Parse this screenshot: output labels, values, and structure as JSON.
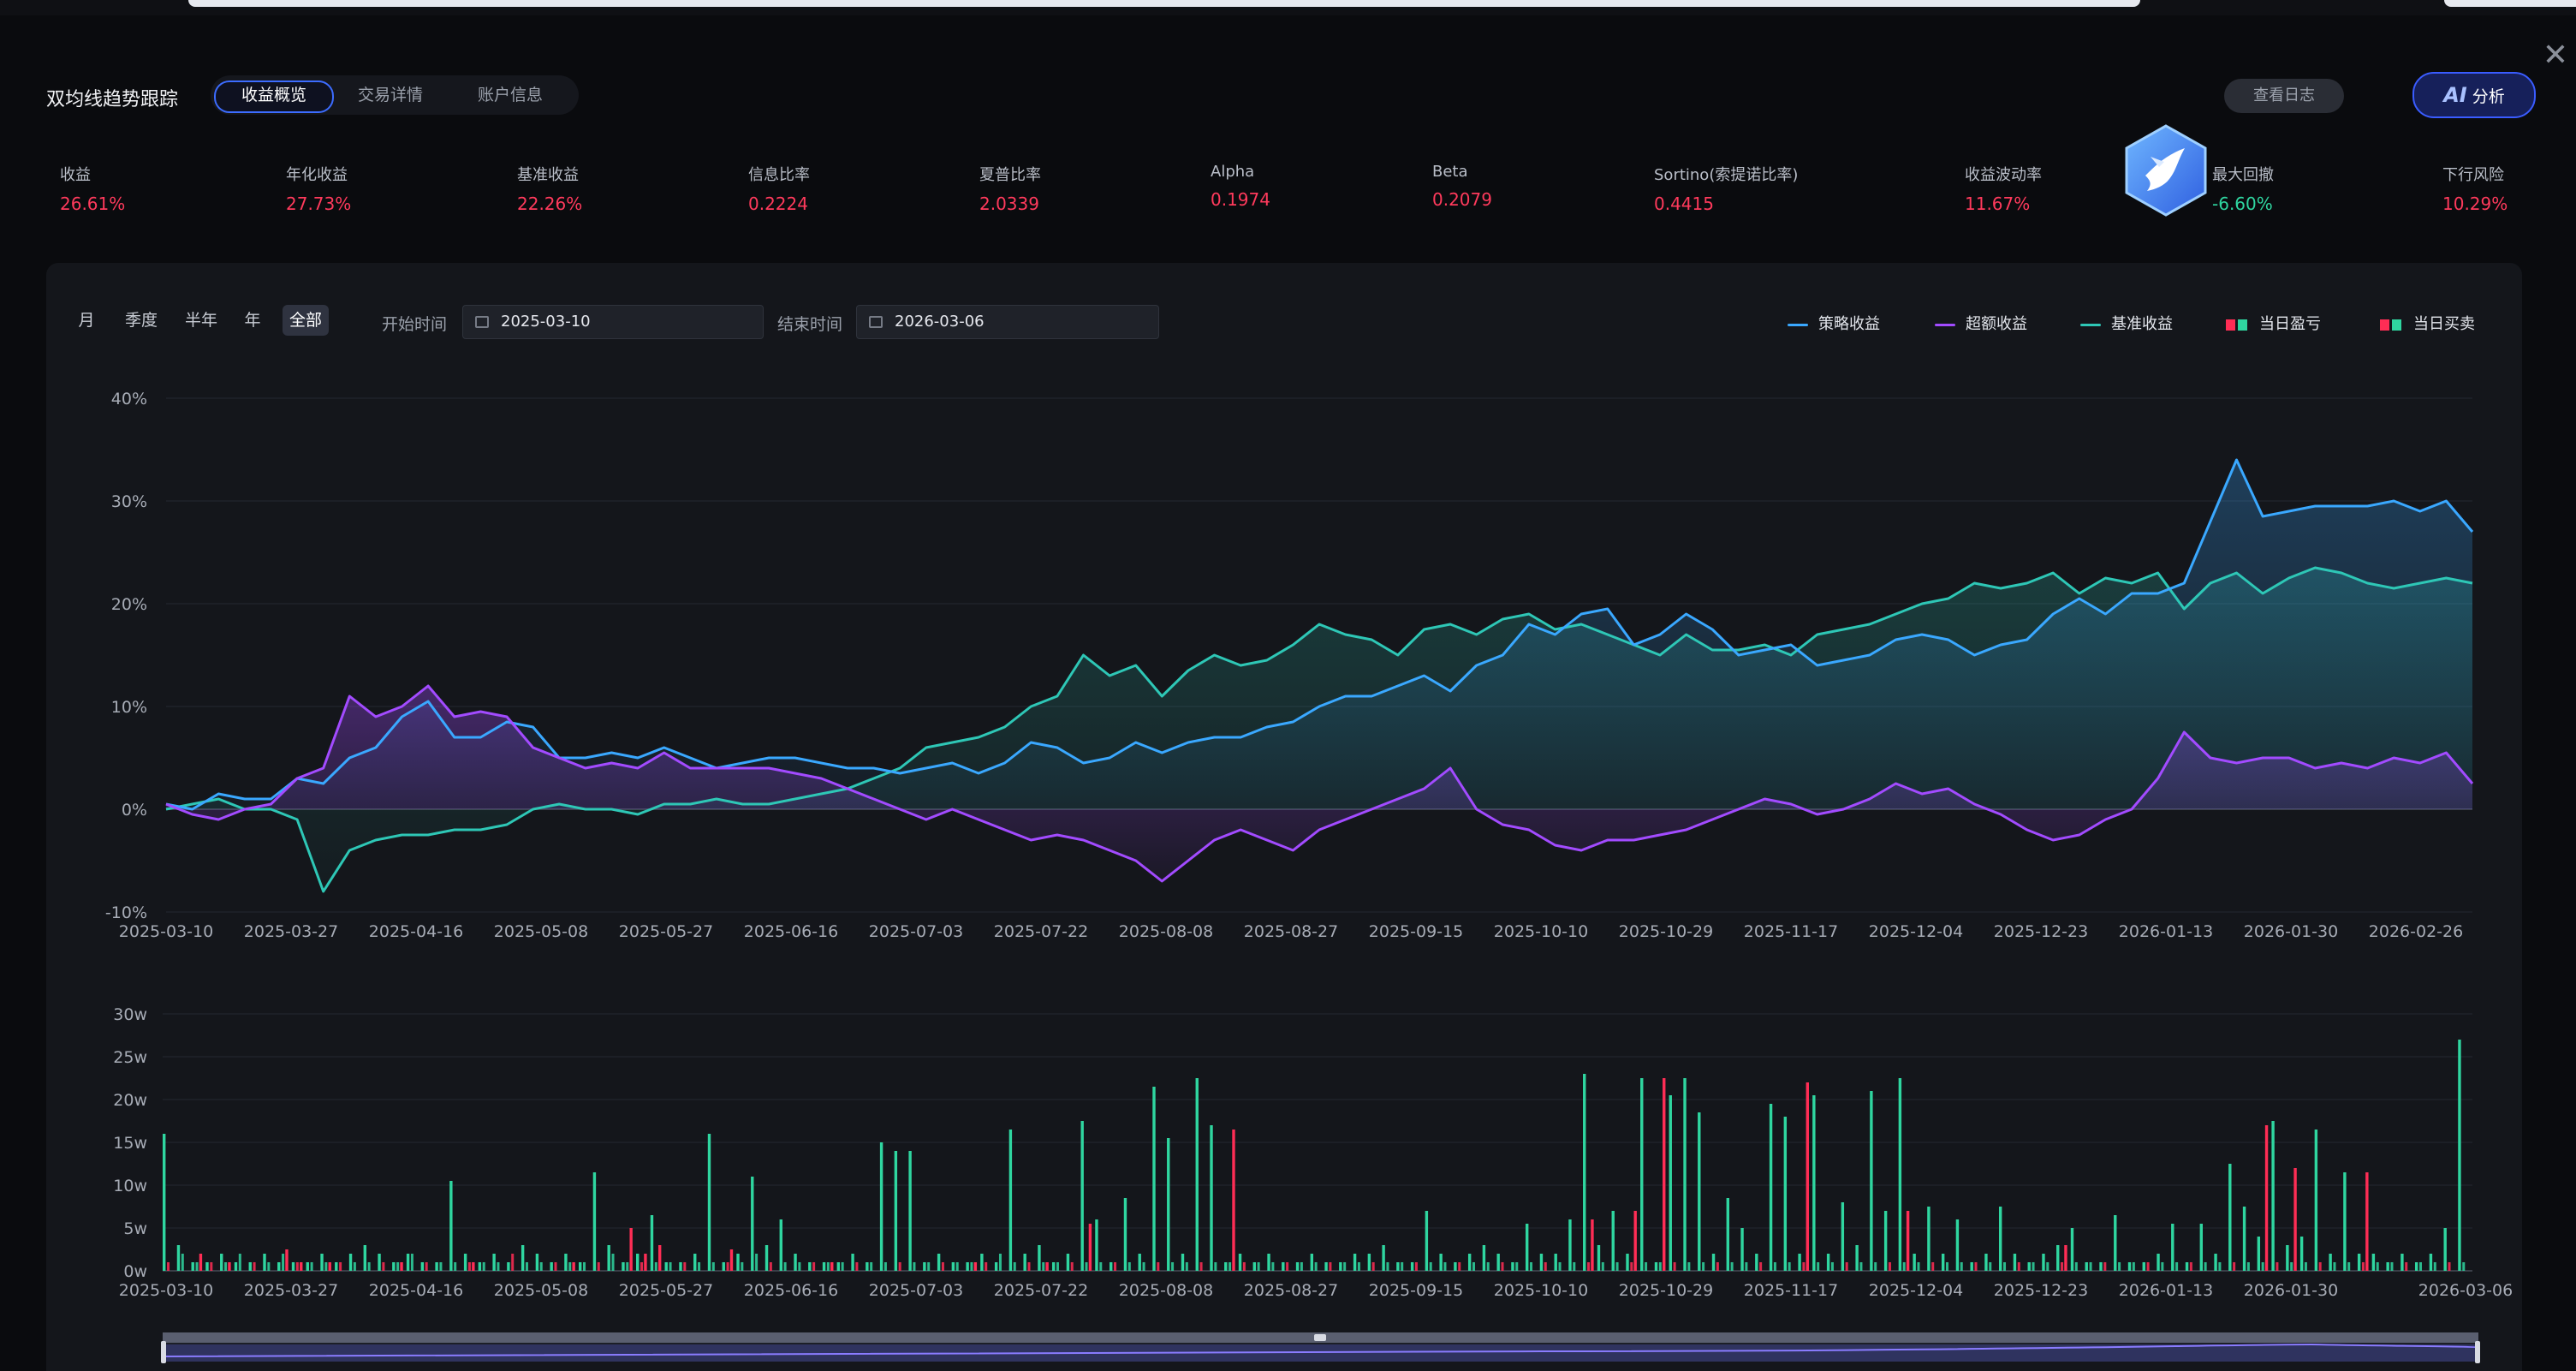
{
  "page": {
    "title": "双均线趋势跟踪",
    "tabs": [
      {
        "label": "收益概览",
        "active": true
      },
      {
        "label": "交易详情",
        "active": false
      },
      {
        "label": "账户信息",
        "active": false
      }
    ],
    "log_button": "查看日志",
    "ai_button": {
      "badge": "AI",
      "label": "分析"
    },
    "close": "✕"
  },
  "stats": [
    {
      "label": "收益",
      "value": "26.61%",
      "color": "#ff3a5c"
    },
    {
      "label": "年化收益",
      "value": "27.73%",
      "color": "#ff3a5c"
    },
    {
      "label": "基准收益",
      "value": "22.26%",
      "color": "#ff3a5c"
    },
    {
      "label": "信息比率",
      "value": "0.2224",
      "color": "#ff3a5c"
    },
    {
      "label": "夏普比率",
      "value": "2.0339",
      "color": "#ff3a5c"
    },
    {
      "label": "Alpha",
      "value": "0.1974",
      "color": "#ff3a5c"
    },
    {
      "label": "Beta",
      "value": "0.2079",
      "color": "#ff3a5c"
    },
    {
      "label": "Sortino(索提诺比率)",
      "value": "0.4415",
      "color": "#ff3a5c"
    },
    {
      "label": "收益波动率",
      "value": "11.67%",
      "color": "#ff3a5c"
    },
    {
      "label": "最大回撤",
      "value": "-6.60%",
      "color": "#2fd6a0"
    },
    {
      "label": "下行风险",
      "value": "10.29%",
      "color": "#ff3a5c"
    }
  ],
  "controls": {
    "periods": [
      {
        "label": "月",
        "active": false
      },
      {
        "label": "季度",
        "active": false
      },
      {
        "label": "半年",
        "active": false
      },
      {
        "label": "年",
        "active": false
      },
      {
        "label": "全部",
        "active": true
      }
    ],
    "start_label": "开始时间",
    "start_value": "2025-03-10",
    "end_label": "结束时间",
    "end_value": "2026-03-06"
  },
  "legend": [
    {
      "label": "策略收益",
      "color": "#3aa8ff",
      "kind": "line"
    },
    {
      "label": "超额收益",
      "color": "#a24bff",
      "kind": "line"
    },
    {
      "label": "基准收益",
      "color": "#2ec7b6",
      "kind": "line"
    },
    {
      "label": "当日盈亏",
      "colors": [
        "#ff2d55",
        "#2fd6a0"
      ],
      "kind": "squares"
    },
    {
      "label": "当日买卖",
      "colors": [
        "#ff2d55",
        "#2fd6a0"
      ],
      "kind": "squares"
    }
  ],
  "colors": {
    "strategy": "#3aa8ff",
    "excess": "#a24bff",
    "benchmark": "#2ec7b6",
    "up": "#ff2d55",
    "down": "#2fd6a0",
    "grid": "#252831",
    "axis_text": "#a7acb6"
  },
  "chart_data": [
    {
      "type": "line",
      "title": "",
      "xlabel": "",
      "ylabel": "",
      "ylim": [
        -10,
        40
      ],
      "yticks": [
        "40%",
        "30%",
        "20%",
        "10%",
        "0%",
        "-10%"
      ],
      "yticks_values": [
        40,
        30,
        20,
        10,
        0,
        -10
      ],
      "xtick_labels": [
        "2025-03-10",
        "2025-03-27",
        "2025-04-16",
        "2025-05-08",
        "2025-05-27",
        "2025-06-16",
        "2025-07-03",
        "2025-07-22",
        "2025-08-08",
        "2025-08-27",
        "2025-09-15",
        "2025-10-10",
        "2025-10-29",
        "2025-11-17",
        "2025-12-04",
        "2025-12-23",
        "2026-01-13",
        "2026-01-30",
        "2026-02-26"
      ],
      "grid": true,
      "legend_placement": "top-right",
      "series": [
        {
          "name": "策略收益",
          "key": "strategy",
          "values": [
            0.5,
            0,
            1.5,
            1,
            1,
            3,
            2.5,
            5,
            6,
            9,
            10.5,
            7,
            7,
            8.5,
            8,
            5,
            5,
            5.5,
            5,
            6,
            5,
            4,
            4.5,
            5,
            5,
            4.5,
            4,
            4,
            3.5,
            4,
            4.5,
            3.5,
            4.5,
            6.5,
            6,
            4.5,
            5,
            6.5,
            5.5,
            6.5,
            7,
            7,
            8,
            8.5,
            10,
            11,
            11,
            12,
            13,
            11.5,
            14,
            15,
            18,
            17,
            19,
            19.5,
            16,
            17,
            19,
            17.5,
            15,
            15.5,
            16,
            14,
            14.5,
            15,
            16.5,
            17,
            16.5,
            15,
            16,
            16.5,
            19,
            20.5,
            19,
            21,
            21,
            22,
            28,
            34,
            28.5,
            29,
            29.5,
            29.5,
            29.5,
            30,
            29,
            30,
            27
          ]
        },
        {
          "name": "超额收益",
          "key": "excess",
          "values": [
            0.5,
            -0.5,
            -1,
            0,
            0.5,
            3,
            4,
            11,
            9,
            10,
            12,
            9,
            9.5,
            9,
            6,
            5,
            4,
            4.5,
            4,
            5.5,
            4,
            4,
            4,
            4,
            3.5,
            3,
            2,
            1,
            0,
            -1,
            0,
            -1,
            -2,
            -3,
            -2.5,
            -3,
            -4,
            -5,
            -7,
            -5,
            -3,
            -2,
            -3,
            -4,
            -2,
            -1,
            0,
            1,
            2,
            4,
            0,
            -1.5,
            -2,
            -3.5,
            -4,
            -3,
            -3,
            -2.5,
            -2,
            -1,
            0,
            1,
            0.5,
            -0.5,
            0,
            1,
            2.5,
            1.5,
            2,
            0.5,
            -0.5,
            -2,
            -3,
            -2.5,
            -1,
            0,
            3,
            7.5,
            5,
            4.5,
            5,
            5,
            4,
            4.5,
            4,
            5,
            4.5,
            5.5,
            2.5
          ]
        },
        {
          "name": "基准收益",
          "key": "benchmark",
          "values": [
            0,
            0.5,
            1,
            0,
            0,
            -1,
            -8,
            -4,
            -3,
            -2.5,
            -2.5,
            -2,
            -2,
            -1.5,
            0,
            0.5,
            0,
            0,
            -0.5,
            0.5,
            0.5,
            1,
            0.5,
            0.5,
            1,
            1.5,
            2,
            3,
            4,
            6,
            6.5,
            7,
            8,
            10,
            11,
            15,
            13,
            14,
            11,
            13.5,
            15,
            14,
            14.5,
            16,
            18,
            17,
            16.5,
            15,
            17.5,
            18,
            17,
            18.5,
            19,
            17.5,
            18,
            17,
            16,
            15,
            17,
            15.5,
            15.5,
            16,
            15,
            17,
            17.5,
            18,
            19,
            20,
            20.5,
            22,
            21.5,
            22,
            23,
            21,
            22.5,
            22,
            23,
            19.5,
            22,
            23,
            21,
            22.5,
            23.5,
            23,
            22,
            21.5,
            22,
            22.5,
            22
          ]
        }
      ]
    },
    {
      "type": "bar",
      "title": "",
      "xlabel": "",
      "ylabel": "",
      "ylim": [
        0,
        30
      ],
      "unit": "w",
      "yticks": [
        "30w",
        "25w",
        "20w",
        "15w",
        "10w",
        "5w",
        "0w"
      ],
      "yticks_values": [
        30,
        25,
        20,
        15,
        10,
        5,
        0
      ],
      "xtick_labels": [
        "2025-03-10",
        "2025-03-27",
        "2025-04-16",
        "2025-05-08",
        "2025-05-27",
        "2025-06-16",
        "2025-07-03",
        "2025-07-22",
        "2025-08-08",
        "2025-08-27",
        "2025-09-15",
        "2025-10-10",
        "2025-10-29",
        "2025-11-17",
        "2025-12-04",
        "2025-12-23",
        "2026-01-13",
        "2026-01-30",
        "2026-03-06"
      ],
      "grid": true,
      "series": [
        {
          "name": "当日盈亏",
          "values": [
            16,
            3,
            1,
            1,
            2,
            1,
            1,
            2,
            1,
            1,
            1,
            2,
            1,
            2,
            3,
            2,
            1,
            2,
            1,
            1,
            10.5,
            2,
            1,
            2,
            1,
            3,
            2,
            1,
            2,
            1,
            11.5,
            3,
            1,
            2,
            6.5,
            1,
            1,
            2,
            16,
            1,
            2,
            11,
            3,
            6,
            2,
            1,
            1,
            1,
            2,
            1,
            15,
            14,
            14,
            1,
            2,
            1,
            1,
            2,
            1,
            16.5,
            2,
            3,
            1,
            2,
            17.5,
            6,
            1,
            8.5,
            2,
            21.5,
            15.5,
            2,
            22.5,
            17,
            1,
            2,
            1,
            2,
            1,
            1,
            2,
            1,
            1,
            2,
            2,
            3,
            1,
            1,
            7,
            2,
            1,
            2,
            3,
            2,
            1,
            5.5,
            2,
            2,
            6,
            23,
            3,
            7,
            2,
            22.5,
            1,
            20.5,
            22.5,
            18.5,
            2,
            8.5,
            5,
            2,
            19.5,
            18,
            2,
            20.5,
            2,
            8,
            3,
            21,
            7,
            22.5,
            2,
            7.5,
            2,
            6,
            1,
            2,
            7.5,
            2,
            1,
            2,
            3,
            5,
            1,
            1,
            6.5,
            1,
            1,
            2,
            5.5,
            1,
            5.5,
            2,
            12.5,
            7.5,
            4,
            17.5,
            3,
            4,
            16.5,
            2,
            11.5,
            2,
            2,
            1,
            2,
            1,
            2,
            5,
            27
          ]
        },
        {
          "name": "当日买卖",
          "values": [
            1,
            2,
            1,
            1,
            1,
            2,
            1,
            1,
            2,
            1,
            1,
            1,
            1,
            1,
            1,
            1,
            1,
            2,
            1,
            1,
            1,
            1,
            1,
            1,
            2,
            1,
            1,
            1,
            1,
            1,
            1,
            2,
            1,
            1,
            1,
            1,
            1,
            1,
            1,
            1,
            1,
            2,
            1,
            1,
            1,
            1,
            1,
            1,
            1,
            1,
            1,
            1,
            1,
            1,
            1,
            1,
            1,
            1,
            2,
            1,
            1,
            1,
            1,
            1,
            1,
            1,
            1,
            1,
            1,
            1,
            1,
            1,
            1,
            1,
            1,
            1,
            1,
            1,
            1,
            1,
            1,
            1,
            1,
            1,
            1,
            1,
            1,
            1,
            1,
            1,
            1,
            1,
            1,
            1,
            1,
            1,
            1,
            1,
            1,
            1,
            1,
            1,
            1,
            1,
            1,
            1,
            1,
            1,
            1,
            1,
            1,
            1,
            1,
            1,
            1,
            1,
            1,
            1,
            1,
            1,
            1,
            1,
            1,
            1,
            1,
            1,
            1,
            1,
            1,
            1,
            1,
            1,
            1,
            1,
            1,
            1,
            1,
            1,
            1,
            1,
            1,
            1,
            1,
            1,
            1,
            1,
            1,
            1,
            1,
            1,
            1,
            1,
            1,
            1,
            1,
            1,
            1,
            1,
            1,
            1,
            1,
            1,
            1,
            9.5
          ]
        },
        {
          "name": "当日盈亏(负)",
          "values": [
            0,
            0,
            2,
            0,
            1,
            0,
            0,
            0,
            2.5,
            1,
            0,
            1,
            0,
            0,
            0,
            0,
            1,
            0,
            0,
            0,
            0,
            1,
            0,
            0,
            0,
            0,
            0,
            0,
            1,
            0,
            0,
            0,
            5,
            2,
            3,
            0,
            0,
            0,
            0,
            2.5,
            0,
            0,
            0,
            0,
            0,
            0,
            1,
            0,
            0,
            0,
            0,
            0,
            0,
            0,
            0,
            0,
            1,
            0,
            0,
            0,
            0,
            1,
            0,
            0,
            5.5,
            0,
            0,
            0,
            0,
            0,
            0,
            0,
            0,
            0,
            16.5,
            0,
            0,
            0,
            0,
            0,
            0,
            0,
            0,
            0,
            0,
            0,
            0,
            0,
            0,
            0,
            0,
            0,
            0,
            0,
            0,
            0,
            0,
            0,
            0,
            6,
            0,
            0,
            7,
            0,
            22.5,
            0,
            0,
            0,
            0,
            0,
            0,
            0,
            0,
            0,
            22,
            0,
            0,
            0,
            0,
            0,
            0,
            7,
            0,
            0,
            0,
            0,
            0,
            0,
            0,
            0,
            0,
            0,
            3,
            0,
            0,
            0,
            0,
            0,
            0,
            0,
            0,
            0,
            0,
            0,
            0,
            0,
            17,
            0,
            12,
            0,
            0,
            0,
            0,
            11.5,
            0,
            0,
            0,
            0,
            0,
            0,
            0,
            0
          ]
        }
      ]
    }
  ]
}
